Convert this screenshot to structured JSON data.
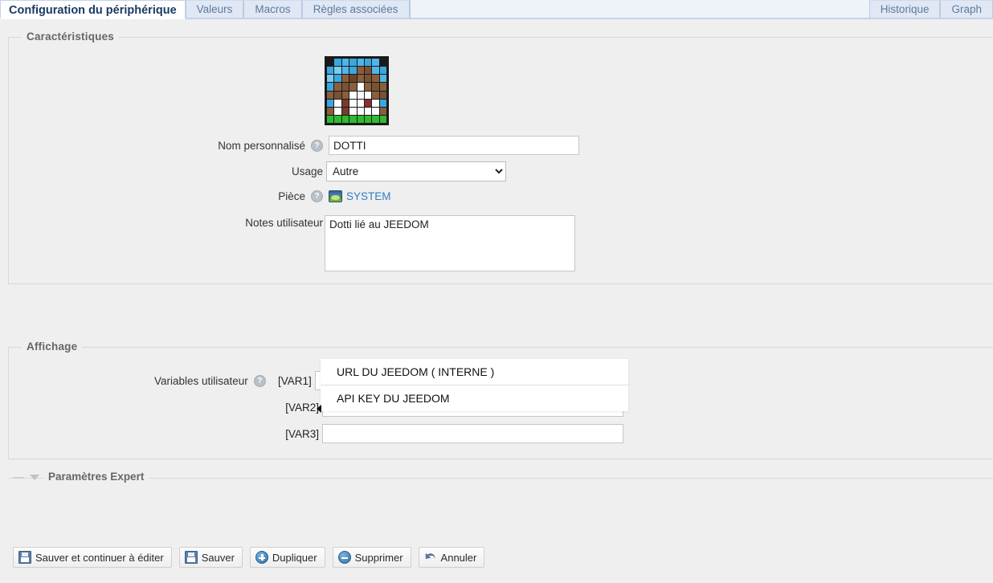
{
  "tabs": {
    "left": [
      {
        "label": "Configuration du périphérique",
        "active": true
      },
      {
        "label": "Valeurs",
        "active": false
      },
      {
        "label": "Macros",
        "active": false
      },
      {
        "label": "Règles associées",
        "active": false
      }
    ],
    "right": [
      {
        "label": "Historique",
        "active": false
      },
      {
        "label": "Graph",
        "active": false
      }
    ]
  },
  "characteristics": {
    "legend": "Caractéristiques",
    "device_icon_name": "minecraft-pixel-art-icon",
    "fields": {
      "name_label": "Nom personnalisé",
      "name_value": "DOTTI",
      "usage_label": "Usage",
      "usage_value": "Autre",
      "usage_options": [
        "Autre"
      ],
      "room_label": "Pièce",
      "room_value": "SYSTEM",
      "notes_label": "Notes utilisateur",
      "notes_value": "Dotti lié au JEEDOM",
      "help_glyph": "?"
    }
  },
  "display": {
    "legend": "Affichage",
    "user_vars_label": "Variables utilisateur",
    "help_glyph": "?",
    "vars": [
      {
        "tag": "[VAR1]",
        "value": ""
      },
      {
        "tag": "[VAR2]",
        "value": ""
      },
      {
        "tag": "[VAR3]",
        "value": ""
      }
    ],
    "suggestions": [
      "URL DU JEEDOM ( INTERNE )",
      "API KEY DU JEEDOM"
    ]
  },
  "expert": {
    "title": "Paramètres Expert"
  },
  "buttons": [
    {
      "label": "Sauver et continuer à éditer",
      "icon": "save-icon"
    },
    {
      "label": "Sauver",
      "icon": "save-icon"
    },
    {
      "label": "Dupliquer",
      "icon": "duplicate-icon"
    },
    {
      "label": "Supprimer",
      "icon": "delete-icon"
    },
    {
      "label": "Annuler",
      "icon": "undo-icon"
    }
  ],
  "colors": {
    "accent": "#2c7fc4",
    "tab_active_text": "#1b3a63",
    "tab_inactive_bg": "#dfe8f4",
    "page_bg": "#efefef"
  },
  "device_pixels": [
    [
      "#1a1a1a",
      "#3aa8e0",
      "#4fb6e8",
      "#3aa8e0",
      "#4fb6e8",
      "#3aa8e0",
      "#4fb6e8",
      "#1a1a1a"
    ],
    [
      "#3aa8e0",
      "#79cdf0",
      "#4fb6e8",
      "#3aa8e0",
      "#8b5e3c",
      "#7a5233",
      "#4fb6e8",
      "#3aa8e0"
    ],
    [
      "#79cdf0",
      "#3aa8e0",
      "#8b5e3c",
      "#6b4426",
      "#8b5e3c",
      "#7a5233",
      "#8b5e3c",
      "#4fb6e8"
    ],
    [
      "#3aa8e0",
      "#8b5e3c",
      "#7a5233",
      "#8b5e3c",
      "#ffffff",
      "#8b5e3c",
      "#7a5233",
      "#8b5e3c"
    ],
    [
      "#8b5e3c",
      "#7a5233",
      "#8b5e3c",
      "#ffffff",
      "#ffffff",
      "#ffffff",
      "#8b5e3c",
      "#7a5233"
    ],
    [
      "#3aa8e0",
      "#ffffff",
      "#7a3b2a",
      "#ffffff",
      "#ffffff",
      "#8b2f2f",
      "#ffffff",
      "#3aa8e0"
    ],
    [
      "#8b5e3c",
      "#ffffff",
      "#7a3b2a",
      "#ffffff",
      "#ffffff",
      "#ffffff",
      "#ffffff",
      "#8b5e3c"
    ],
    [
      "#2fbb2f",
      "#2fbb2f",
      "#2fbb2f",
      "#2fbb2f",
      "#2fbb2f",
      "#2fbb2f",
      "#2fbb2f",
      "#2fbb2f"
    ]
  ]
}
